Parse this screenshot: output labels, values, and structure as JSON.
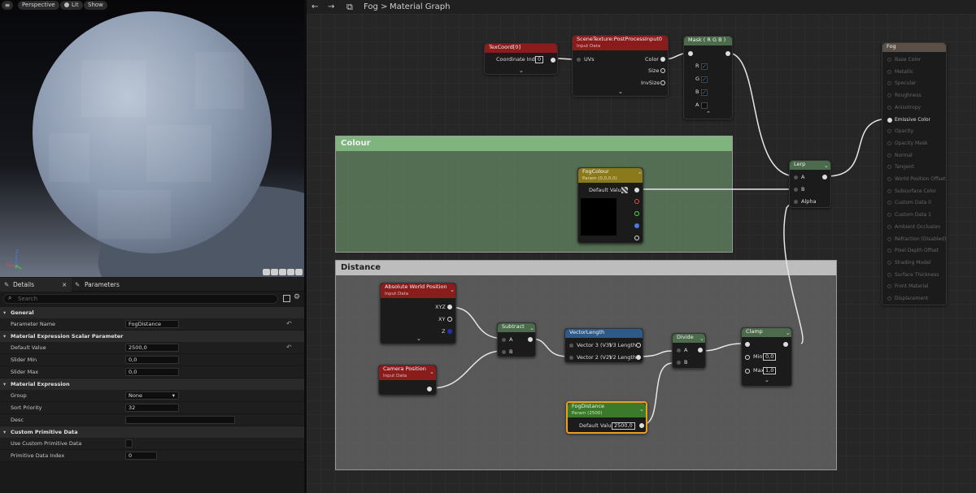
{
  "viewport": {
    "perspective_label": "Perspective",
    "lit_label": "Lit",
    "show_label": "Show",
    "axis": {
      "z": "Z",
      "x": "X",
      "y": "Y"
    }
  },
  "details": {
    "tab_details": "Details",
    "tab_parameters": "Parameters",
    "search_placeholder": "Search",
    "sections": {
      "general": "General",
      "scalar": "Material Expression Scalar Parameter",
      "expression": "Material Expression",
      "primitive": "Custom Primitive Data"
    },
    "rows": {
      "parameter_name": {
        "label": "Parameter Name",
        "value": "FogDistance"
      },
      "default_value": {
        "label": "Default Value",
        "value": "2500,0"
      },
      "slider_min": {
        "label": "Slider Min",
        "value": "0,0"
      },
      "slider_max": {
        "label": "Slider Max",
        "value": "0,0"
      },
      "group": {
        "label": "Group",
        "value": "None"
      },
      "sort_priority": {
        "label": "Sort Priority",
        "value": "32"
      },
      "desc": {
        "label": "Desc",
        "value": ""
      },
      "use_custom": {
        "label": "Use Custom Primitive Data"
      },
      "prim_index": {
        "label": "Primitive Data Index",
        "value": "0"
      }
    }
  },
  "graph": {
    "breadcrumb_root": "Fog",
    "breadcrumb_sep": ">",
    "breadcrumb_current": "Material Graph",
    "comments": {
      "colour": "Colour",
      "distance": "Distance"
    },
    "nodes": {
      "texcoord": {
        "title": "TexCoord[0]",
        "pin": "Coordinate Index",
        "value": "0"
      },
      "scenetex": {
        "title": "SceneTexture:PostProcessInput0",
        "sub": "Input Data",
        "in": "UVs",
        "out1": "Color",
        "out2": "Size",
        "out3": "InvSize"
      },
      "mask": {
        "title": "Mask ( R G B )",
        "r": "R",
        "g": "G",
        "b": "B",
        "a": "A"
      },
      "fogcolour": {
        "title": "FogColour",
        "sub": "Param (0,0,0,0)",
        "pin": "Default Value"
      },
      "lerp": {
        "title": "Lerp",
        "a": "A",
        "b": "B",
        "alpha": "Alpha"
      },
      "absworld": {
        "title": "Absolute World Position",
        "sub": "Input Data",
        "o1": "XYZ",
        "o2": "XY",
        "o3": "Z"
      },
      "campos": {
        "title": "Camera Position",
        "sub": "Input Data"
      },
      "subtract": {
        "title": "Subtract",
        "a": "A",
        "b": "B"
      },
      "veclen": {
        "title": "VectorLength",
        "i1": "Vector 3 (V3)",
        "o1": "V3 Length",
        "i2": "Vector 2 (V2)",
        "o2": "V2 Length"
      },
      "divide": {
        "title": "Divide",
        "a": "A",
        "b": "B"
      },
      "clamp": {
        "title": "Clamp",
        "min": "Min",
        "minv": "0,0",
        "max": "Max",
        "maxv": "1,0"
      },
      "fogdist": {
        "title": "FogDistance",
        "sub": "Param (2500)",
        "pin": "Default Value",
        "value": "2500,0"
      }
    },
    "result": {
      "title": "Fog",
      "pins": [
        "Base Color",
        "Metallic",
        "Specular",
        "Roughness",
        "Anisotropy",
        "Emissive Color",
        "Opacity",
        "Opacity Mask",
        "Normal",
        "Tangent",
        "World Position Offset",
        "Subsurface Color",
        "Custom Data 0",
        "Custom Data 1",
        "Ambient Occlusion",
        "Refraction (Disabled)",
        "Pixel Depth Offset",
        "Shading Model",
        "Surface Thickness",
        "Front Material",
        "Displacement"
      ]
    }
  }
}
